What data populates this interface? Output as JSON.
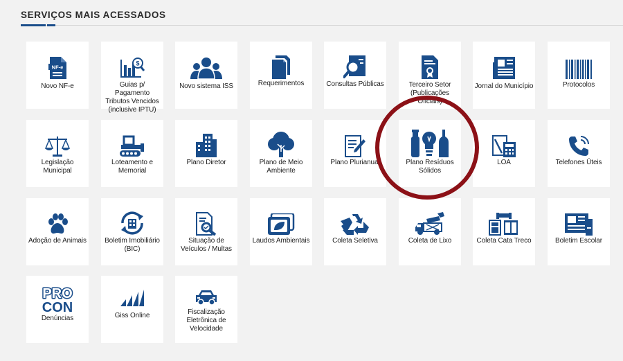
{
  "section": {
    "title": "SERVIÇOS MAIS ACESSADOS"
  },
  "colors": {
    "icon": "#1a4d8a",
    "highlight": "#8c1117",
    "card": "#ffffff",
    "background": "#f2f2f2"
  },
  "services": [
    {
      "label": "Novo NF-e",
      "icon": "nfe-document-icon",
      "icon_text": "NF-e"
    },
    {
      "label": "Guias p/ Pagamento Tributos Vencidos (inclusive IPTU)",
      "icon": "bar-chart-coin-icon"
    },
    {
      "label": "Novo sistema ISS",
      "icon": "people-group-icon"
    },
    {
      "label": "Requerimentos",
      "icon": "documents-stack-icon"
    },
    {
      "label": "Consultas Públicas",
      "icon": "search-document-icon"
    },
    {
      "label": "Terceiro Setor (Publicações Oficiais)",
      "icon": "certificate-document-icon"
    },
    {
      "label": "Jornal do Município",
      "icon": "newspaper-icon"
    },
    {
      "label": "Protocolos",
      "icon": "barcode-icon"
    },
    {
      "label": "Legislação Municipal",
      "icon": "scales-icon"
    },
    {
      "label": "Loteamento e Memorial",
      "icon": "bulldozer-icon"
    },
    {
      "label": "Plano Diretor",
      "icon": "buildings-icon"
    },
    {
      "label": "Plano de Meio Ambiente",
      "icon": "tree-icon"
    },
    {
      "label": "Plano Plurianual",
      "icon": "document-pen-icon"
    },
    {
      "label": "Plano Resíduos Sólidos",
      "icon": "recyclables-icon"
    },
    {
      "label": "LOA",
      "icon": "document-calculator-icon"
    },
    {
      "label": "Telefones Úteis",
      "icon": "phone-icon"
    },
    {
      "label": "Adoção de Animais",
      "icon": "paw-icon"
    },
    {
      "label": "Boletim Imobiliário (BIC)",
      "icon": "building-refresh-icon"
    },
    {
      "label": "Situação de Veículos / Multas",
      "icon": "document-magnifier-icon"
    },
    {
      "label": "Laudos Ambientais",
      "icon": "leaf-screen-icon"
    },
    {
      "label": "Coleta Seletiva",
      "icon": "recycle-icon"
    },
    {
      "label": "Coleta de Lixo",
      "icon": "garbage-truck-icon"
    },
    {
      "label": "Coleta Cata Treco",
      "icon": "furniture-icon"
    },
    {
      "label": "Boletim Escolar",
      "icon": "report-card-icon"
    },
    {
      "label": "Denúncias",
      "icon": "procon-logo-icon",
      "icon_text_top": "PRO",
      "icon_text_bottom": "CON"
    },
    {
      "label": "Giss Online",
      "icon": "giss-bars-icon"
    },
    {
      "label": "Fiscalização Eletrônica de Velocidade",
      "icon": "car-icon"
    }
  ]
}
